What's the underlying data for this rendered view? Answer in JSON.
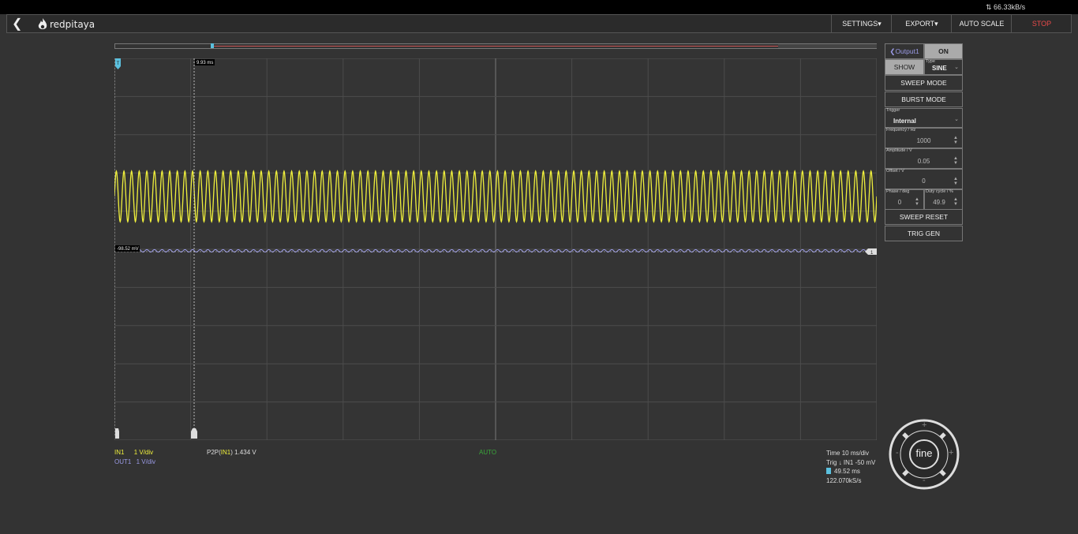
{
  "status": {
    "data_rate": "66.33kB/s"
  },
  "brand": {
    "name": "redpitaya"
  },
  "nav": {
    "settings": "SETTINGS▾",
    "export": "EXPORT▾",
    "autoscale": "AUTO SCALE",
    "stop": "STOP"
  },
  "cursor": {
    "time_label": "9.93 ms",
    "volt_label": "-98.52 mV",
    "trig_marker": "T",
    "ch_marker": "1"
  },
  "generator": {
    "output_label": "Output1",
    "on_label": "ON",
    "show_label": "SHOW",
    "type_label": "Type",
    "type_value": "SINE",
    "sweep_mode": "SWEEP MODE",
    "burst_mode": "BURST MODE",
    "trigger_label": "Trigger",
    "trigger_value": "Internal",
    "frequency_label": "Frequency / Hz",
    "frequency_value": "1000",
    "amplitude_label": "Amplitude / V",
    "amplitude_value": "0.05",
    "offset_label": "Offset / V",
    "offset_value": "0",
    "phase_label": "Phase / deg",
    "phase_value": "0",
    "duty_label": "Duty cycle / %",
    "duty_value": "49.9",
    "sweep_reset": "SWEEP RESET",
    "trig_gen": "TRIG GEN"
  },
  "channels": {
    "in1_name": "IN1",
    "in1_scale": "1 V/div",
    "out1_name": "OUT1",
    "out1_scale": "1 V/div",
    "meas_prefix": "P2P(",
    "meas_ch": "IN1",
    "meas_suffix": ") 1.434 V"
  },
  "trigger_mode": "AUTO",
  "timebase": {
    "time": "Time 10 ms/div",
    "trig": "Trig ↓ IN1 -50 mV",
    "delay": "49.52 ms",
    "sample_rate": "122.070kS/s"
  },
  "joystick": {
    "center": "fine",
    "up": "+",
    "down": "-",
    "left": "-",
    "right": "+"
  },
  "colors": {
    "in1": "#f0f03c",
    "out1": "#9a9ae6",
    "trigger": "#5bc0de",
    "stop": "#e84a4a",
    "auto": "#3aa83a"
  }
}
